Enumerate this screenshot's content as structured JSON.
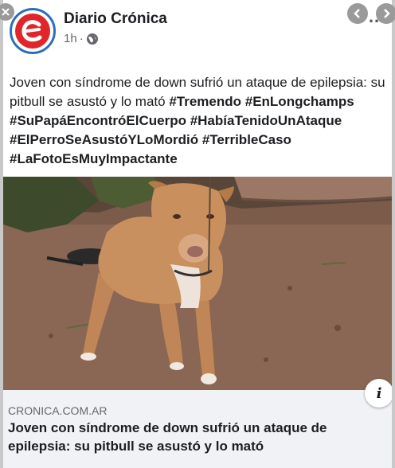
{
  "post": {
    "page_name": "Diario Crónica",
    "time": "1h",
    "separator": "·",
    "audience_icon": "globe-icon",
    "text_plain": "Joven con síndrome de down sufrió un ataque de epilepsia: su pitbull se asustó y lo mató ",
    "hashtags": "#Tremendo #EnLongchamps #SuPapáEncontróElCuerpo #HabíaTenidoUnAtaque #ElPerroSeAsustóYLoMordió #TerribleCaso #LaFotoEsMuyImpactante",
    "more_icon": "more-options-icon"
  },
  "link_preview": {
    "domain": "CRONICA.COM.AR",
    "title": "Joven con síndrome de down sufrió un ataque de epilepsia: su pitbull se asustó y lo mató",
    "info_icon": "info-icon",
    "info_glyph": "i"
  },
  "viewer_controls": {
    "close_icon": "close-icon",
    "back_icon": "chevron-left-icon",
    "forward_icon": "chevron-right-icon"
  },
  "colors": {
    "brand_red": "#e0262b",
    "brand_blue": "#2a70b8",
    "text": "#1c1e21",
    "secondary_text": "#65676b",
    "link_bg": "#f0f2f5"
  }
}
